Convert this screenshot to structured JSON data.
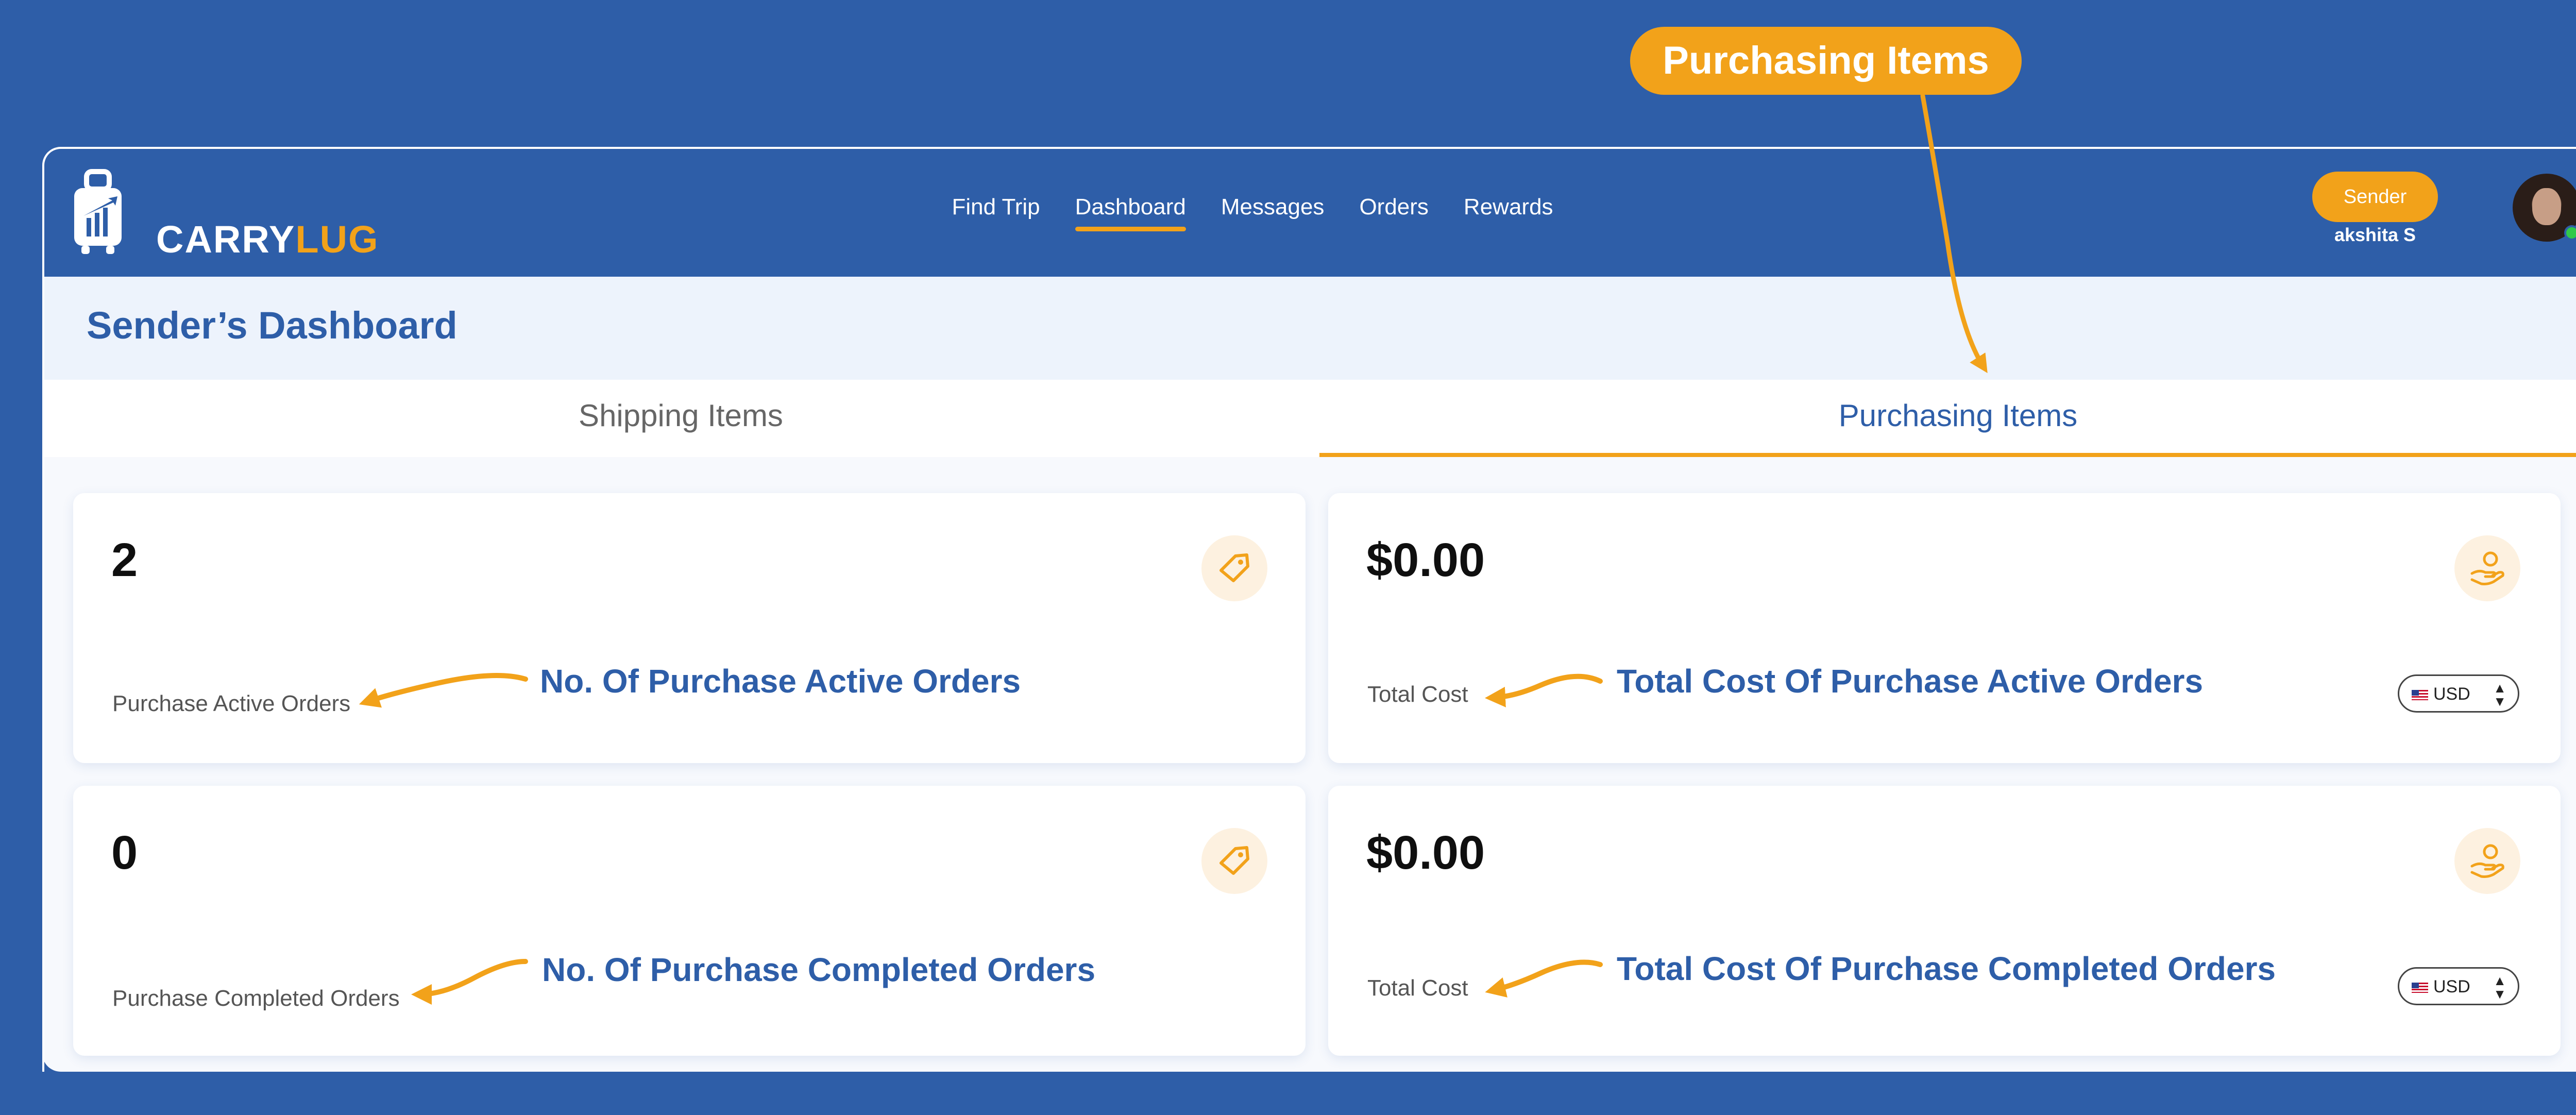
{
  "callout": {
    "label": "Purchasing Items"
  },
  "logo": {
    "part1": "CARRY",
    "part2": "LUG"
  },
  "nav": {
    "items": [
      {
        "label": "Find Trip"
      },
      {
        "label": "Dashboard"
      },
      {
        "label": "Messages"
      },
      {
        "label": "Orders"
      },
      {
        "label": "Rewards"
      }
    ],
    "active": "Dashboard"
  },
  "user": {
    "role": "Sender",
    "name": "akshita S"
  },
  "dashboard": {
    "title": "Sender’s Dashboard"
  },
  "tabs": {
    "shipping": "Shipping Items",
    "purchasing": "Purchasing Items"
  },
  "cards": [
    {
      "value": "2",
      "label": "Purchase Active Orders",
      "icon": "tag-icon"
    },
    {
      "value": "$0.00",
      "label": "Total Cost",
      "icon": "hand-coin-icon",
      "currency": "USD"
    },
    {
      "value": "0",
      "label": "Purchase Completed Orders",
      "icon": "tag-icon"
    },
    {
      "value": "$0.00",
      "label": "Total Cost",
      "icon": "hand-coin-icon",
      "currency": "USD"
    }
  ],
  "annotations": [
    "No. Of Purchase Active Orders",
    "Total Cost Of Purchase Active Orders",
    "No. Of Purchase Completed Orders",
    "Total Cost Of Purchase Completed Orders"
  ],
  "colors": {
    "brand_blue": "#2e5ea8",
    "accent_orange": "#f2a21a",
    "light_panel": "#edf3fc"
  }
}
